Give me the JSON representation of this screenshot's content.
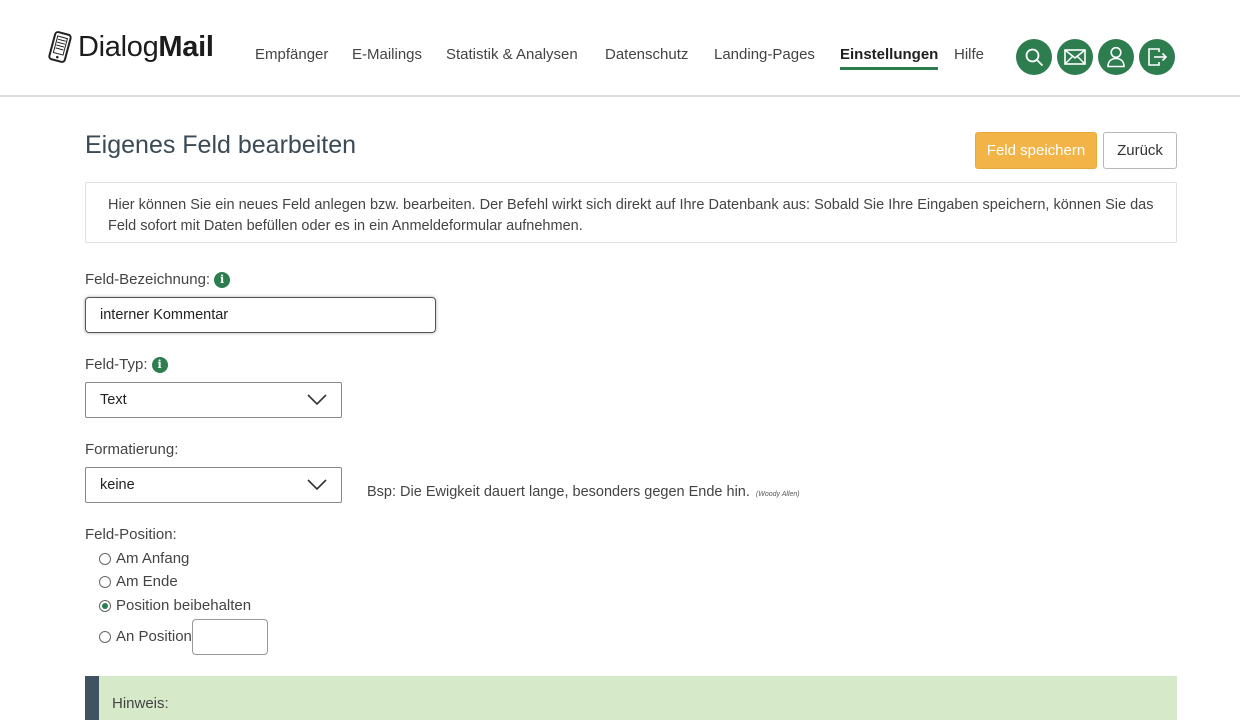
{
  "brand": {
    "name_light": "Dialog",
    "name_bold": "Mail"
  },
  "nav": {
    "items": [
      {
        "label": "Empfänger"
      },
      {
        "label": "E-Mailings"
      },
      {
        "label": "Statistik & Analysen"
      },
      {
        "label": "Datenschutz"
      },
      {
        "label": "Landing-Pages"
      },
      {
        "label": "Einstellungen",
        "active": true
      },
      {
        "label": "Hilfe"
      }
    ],
    "icons": [
      "search-icon",
      "mail-icon",
      "user-icon",
      "logout-icon"
    ]
  },
  "page": {
    "title": "Eigenes Feld bearbeiten",
    "save_label": "Feld speichern",
    "back_label": "Zurück",
    "info_text": "Hier können Sie ein neues Feld anlegen bzw. bearbeiten. Der Befehl wirkt sich direkt auf Ihre Datenbank aus: Sobald Sie Ihre Eingaben speichern, können Sie das Feld sofort mit Daten befüllen oder es in ein Anmeldeformular aufnehmen."
  },
  "form": {
    "name_label": "Feld-Bezeichnung:",
    "name_value": "interner Kommentar",
    "type_label": "Feld-Typ:",
    "type_value": "Text",
    "format_label": "Formatierung:",
    "format_value": "keine",
    "example_text": "Bsp: Die Ewigkeit dauert lange, besonders gegen Ende hin.",
    "example_source": "(Woody Allen)",
    "position_label": "Feld-Position:",
    "position_options": [
      {
        "label": "Am Anfang",
        "checked": false
      },
      {
        "label": "Am Ende",
        "checked": false
      },
      {
        "label": "Position beibehalten",
        "checked": true
      },
      {
        "label": "An Position",
        "checked": false
      }
    ],
    "position_value": ""
  },
  "note": {
    "title": "Hinweis:",
    "text": ""
  },
  "colors": {
    "accent": "#2e7d4f",
    "save": "#f2b447",
    "note_bg": "#d6e9c9",
    "note_border": "#3f5460"
  }
}
